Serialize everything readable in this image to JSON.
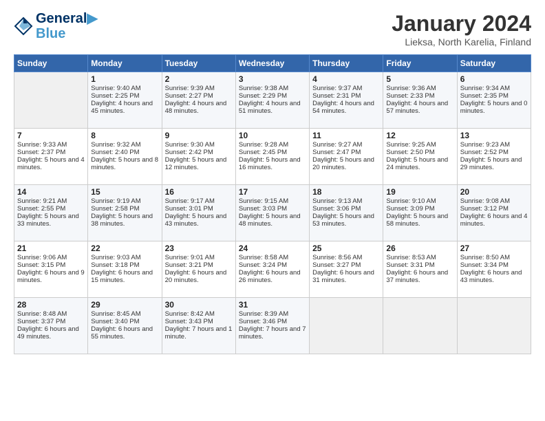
{
  "header": {
    "logo_line1": "General",
    "logo_line2": "Blue",
    "title": "January 2024",
    "subtitle": "Lieksa, North Karelia, Finland"
  },
  "days_of_week": [
    "Sunday",
    "Monday",
    "Tuesday",
    "Wednesday",
    "Thursday",
    "Friday",
    "Saturday"
  ],
  "weeks": [
    [
      {
        "day": "",
        "empty": true
      },
      {
        "day": "1",
        "rise": "Sunrise: 9:40 AM",
        "set": "Sunset: 2:25 PM",
        "daylight": "Daylight: 4 hours and 45 minutes."
      },
      {
        "day": "2",
        "rise": "Sunrise: 9:39 AM",
        "set": "Sunset: 2:27 PM",
        "daylight": "Daylight: 4 hours and 48 minutes."
      },
      {
        "day": "3",
        "rise": "Sunrise: 9:38 AM",
        "set": "Sunset: 2:29 PM",
        "daylight": "Daylight: 4 hours and 51 minutes."
      },
      {
        "day": "4",
        "rise": "Sunrise: 9:37 AM",
        "set": "Sunset: 2:31 PM",
        "daylight": "Daylight: 4 hours and 54 minutes."
      },
      {
        "day": "5",
        "rise": "Sunrise: 9:36 AM",
        "set": "Sunset: 2:33 PM",
        "daylight": "Daylight: 4 hours and 57 minutes."
      },
      {
        "day": "6",
        "rise": "Sunrise: 9:34 AM",
        "set": "Sunset: 2:35 PM",
        "daylight": "Daylight: 5 hours and 0 minutes."
      }
    ],
    [
      {
        "day": "7",
        "rise": "Sunrise: 9:33 AM",
        "set": "Sunset: 2:37 PM",
        "daylight": "Daylight: 5 hours and 4 minutes."
      },
      {
        "day": "8",
        "rise": "Sunrise: 9:32 AM",
        "set": "Sunset: 2:40 PM",
        "daylight": "Daylight: 5 hours and 8 minutes."
      },
      {
        "day": "9",
        "rise": "Sunrise: 9:30 AM",
        "set": "Sunset: 2:42 PM",
        "daylight": "Daylight: 5 hours and 12 minutes."
      },
      {
        "day": "10",
        "rise": "Sunrise: 9:28 AM",
        "set": "Sunset: 2:45 PM",
        "daylight": "Daylight: 5 hours and 16 minutes."
      },
      {
        "day": "11",
        "rise": "Sunrise: 9:27 AM",
        "set": "Sunset: 2:47 PM",
        "daylight": "Daylight: 5 hours and 20 minutes."
      },
      {
        "day": "12",
        "rise": "Sunrise: 9:25 AM",
        "set": "Sunset: 2:50 PM",
        "daylight": "Daylight: 5 hours and 24 minutes."
      },
      {
        "day": "13",
        "rise": "Sunrise: 9:23 AM",
        "set": "Sunset: 2:52 PM",
        "daylight": "Daylight: 5 hours and 29 minutes."
      }
    ],
    [
      {
        "day": "14",
        "rise": "Sunrise: 9:21 AM",
        "set": "Sunset: 2:55 PM",
        "daylight": "Daylight: 5 hours and 33 minutes."
      },
      {
        "day": "15",
        "rise": "Sunrise: 9:19 AM",
        "set": "Sunset: 2:58 PM",
        "daylight": "Daylight: 5 hours and 38 minutes."
      },
      {
        "day": "16",
        "rise": "Sunrise: 9:17 AM",
        "set": "Sunset: 3:01 PM",
        "daylight": "Daylight: 5 hours and 43 minutes."
      },
      {
        "day": "17",
        "rise": "Sunrise: 9:15 AM",
        "set": "Sunset: 3:03 PM",
        "daylight": "Daylight: 5 hours and 48 minutes."
      },
      {
        "day": "18",
        "rise": "Sunrise: 9:13 AM",
        "set": "Sunset: 3:06 PM",
        "daylight": "Daylight: 5 hours and 53 minutes."
      },
      {
        "day": "19",
        "rise": "Sunrise: 9:10 AM",
        "set": "Sunset: 3:09 PM",
        "daylight": "Daylight: 5 hours and 58 minutes."
      },
      {
        "day": "20",
        "rise": "Sunrise: 9:08 AM",
        "set": "Sunset: 3:12 PM",
        "daylight": "Daylight: 6 hours and 4 minutes."
      }
    ],
    [
      {
        "day": "21",
        "rise": "Sunrise: 9:06 AM",
        "set": "Sunset: 3:15 PM",
        "daylight": "Daylight: 6 hours and 9 minutes."
      },
      {
        "day": "22",
        "rise": "Sunrise: 9:03 AM",
        "set": "Sunset: 3:18 PM",
        "daylight": "Daylight: 6 hours and 15 minutes."
      },
      {
        "day": "23",
        "rise": "Sunrise: 9:01 AM",
        "set": "Sunset: 3:21 PM",
        "daylight": "Daylight: 6 hours and 20 minutes."
      },
      {
        "day": "24",
        "rise": "Sunrise: 8:58 AM",
        "set": "Sunset: 3:24 PM",
        "daylight": "Daylight: 6 hours and 26 minutes."
      },
      {
        "day": "25",
        "rise": "Sunrise: 8:56 AM",
        "set": "Sunset: 3:27 PM",
        "daylight": "Daylight: 6 hours and 31 minutes."
      },
      {
        "day": "26",
        "rise": "Sunrise: 8:53 AM",
        "set": "Sunset: 3:31 PM",
        "daylight": "Daylight: 6 hours and 37 minutes."
      },
      {
        "day": "27",
        "rise": "Sunrise: 8:50 AM",
        "set": "Sunset: 3:34 PM",
        "daylight": "Daylight: 6 hours and 43 minutes."
      }
    ],
    [
      {
        "day": "28",
        "rise": "Sunrise: 8:48 AM",
        "set": "Sunset: 3:37 PM",
        "daylight": "Daylight: 6 hours and 49 minutes."
      },
      {
        "day": "29",
        "rise": "Sunrise: 8:45 AM",
        "set": "Sunset: 3:40 PM",
        "daylight": "Daylight: 6 hours and 55 minutes."
      },
      {
        "day": "30",
        "rise": "Sunrise: 8:42 AM",
        "set": "Sunset: 3:43 PM",
        "daylight": "Daylight: 7 hours and 1 minute."
      },
      {
        "day": "31",
        "rise": "Sunrise: 8:39 AM",
        "set": "Sunset: 3:46 PM",
        "daylight": "Daylight: 7 hours and 7 minutes."
      },
      {
        "day": "",
        "empty": true
      },
      {
        "day": "",
        "empty": true
      },
      {
        "day": "",
        "empty": true
      }
    ]
  ]
}
